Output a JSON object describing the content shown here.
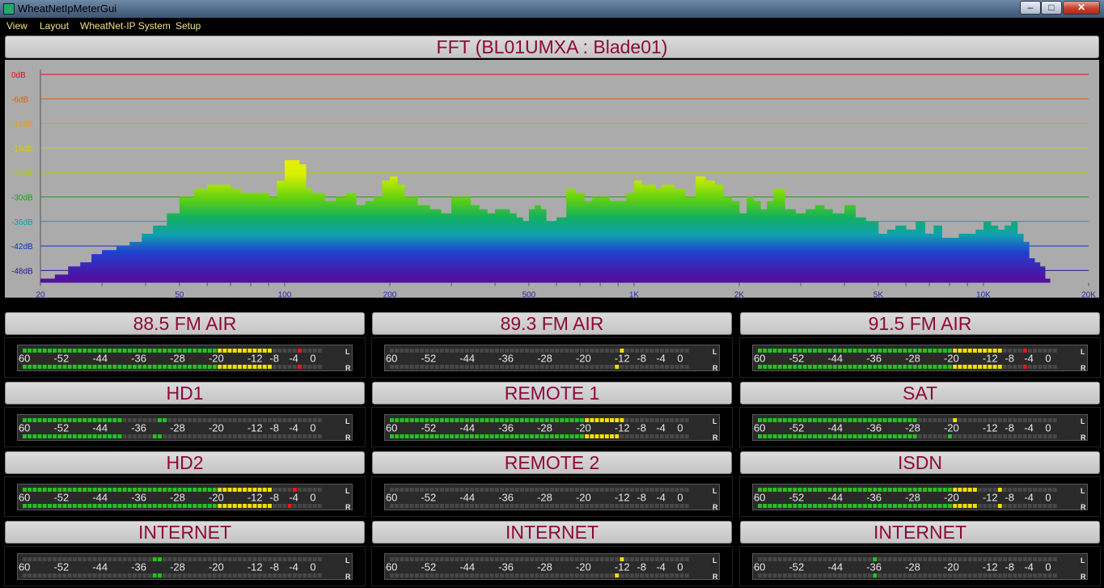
{
  "window": {
    "title": "WheatNetIpMeterGui",
    "minimize_glyph": "–",
    "maximize_glyph": "□",
    "close_glyph": "✕"
  },
  "menu": [
    "View",
    "Layout",
    "WheatNet-IP System",
    "Setup"
  ],
  "fft": {
    "title": "FFT  (BL01UMXA : Blade01)",
    "chart_data": {
      "type": "area",
      "title": "FFT  (BL01UMXA : Blade01)",
      "x_scale": "log",
      "xlim": [
        20,
        20000
      ],
      "ylim": [
        -51,
        0
      ],
      "y_ticks": [
        {
          "label": "0dB",
          "value": 0,
          "color": "#e01010"
        },
        {
          "label": "-6dB",
          "value": -6,
          "color": "#e06010"
        },
        {
          "label": "-12dB",
          "value": -12,
          "color": "#e0a010"
        },
        {
          "label": "-18dB",
          "value": -18,
          "color": "#d8d010"
        },
        {
          "label": "-24dB",
          "value": -24,
          "color": "#a8d010"
        },
        {
          "label": "-30dB",
          "value": -30,
          "color": "#20a020"
        },
        {
          "label": "-36dB",
          "value": -36,
          "color": "#10a0a0"
        },
        {
          "label": "-42dB",
          "value": -42,
          "color": "#1030c0"
        },
        {
          "label": "-48dB",
          "value": -48,
          "color": "#301090"
        }
      ],
      "x_ticks": [
        {
          "label": "20",
          "value": 20
        },
        {
          "label": "50",
          "value": 50
        },
        {
          "label": "100",
          "value": 100
        },
        {
          "label": "200",
          "value": 200
        },
        {
          "label": "500",
          "value": 500
        },
        {
          "label": "1K",
          "value": 1000
        },
        {
          "label": "2K",
          "value": 2000
        },
        {
          "label": "5K",
          "value": 5000
        },
        {
          "label": "10K",
          "value": 10000
        },
        {
          "label": "20K",
          "value": 20000
        }
      ],
      "x": [
        20,
        22,
        24,
        26,
        28,
        30,
        33,
        36,
        39,
        42,
        46,
        50,
        55,
        60,
        65,
        70,
        75,
        80,
        85,
        90,
        95,
        100,
        105,
        110,
        115,
        120,
        130,
        140,
        150,
        160,
        170,
        180,
        190,
        200,
        210,
        220,
        240,
        260,
        280,
        300,
        320,
        340,
        360,
        380,
        400,
        420,
        440,
        460,
        480,
        500,
        520,
        540,
        560,
        600,
        640,
        680,
        720,
        760,
        800,
        850,
        900,
        950,
        1000,
        1050,
        1100,
        1150,
        1200,
        1300,
        1400,
        1500,
        1600,
        1700,
        1800,
        1900,
        2000,
        2100,
        2200,
        2300,
        2400,
        2500,
        2700,
        2900,
        3100,
        3300,
        3500,
        3700,
        4000,
        4300,
        4600,
        5000,
        5300,
        5600,
        6000,
        6400,
        6800,
        7200,
        7600,
        8000,
        8500,
        9000,
        9500,
        10000,
        10500,
        11000,
        11500,
        12000,
        12500,
        13000,
        13500,
        14000,
        14500,
        15000,
        15500,
        16000,
        17000,
        18000,
        19000,
        20000
      ],
      "y": [
        -50,
        -49,
        -47,
        -46,
        -44,
        -43,
        -42,
        -41,
        -39,
        -37,
        -34,
        -30,
        -28,
        -27,
        -27,
        -28,
        -29,
        -29,
        -29,
        -30,
        -26,
        -21,
        -21,
        -22,
        -28,
        -29,
        -31,
        -30,
        -29,
        -32,
        -31,
        -30,
        -26,
        -25,
        -27,
        -30,
        -32,
        -33,
        -34,
        -30,
        -30,
        -32,
        -33,
        -34,
        -33,
        -33,
        -34,
        -35,
        -36,
        -33,
        -32,
        -33,
        -36,
        -35,
        -28,
        -29,
        -31,
        -30,
        -30,
        -31,
        -31,
        -29,
        -26,
        -27,
        -27,
        -28,
        -27,
        -28,
        -30,
        -25,
        -26,
        -27,
        -30,
        -31,
        -34,
        -30,
        -31,
        -33,
        -31,
        -28,
        -33,
        -34,
        -33,
        -32,
        -33,
        -34,
        -32,
        -35,
        -36,
        -39,
        -38,
        -37,
        -38,
        -36,
        -39,
        -37,
        -40,
        -40,
        -39,
        -39,
        -38,
        -36,
        -37,
        -38,
        -37,
        -36,
        -39,
        -41,
        -45,
        -46,
        -47,
        -50,
        -51,
        -51,
        -51,
        -51,
        -51,
        -51
      ]
    }
  },
  "meter_scale": [
    "-60",
    "-52",
    "-44",
    "-36",
    "-28",
    "-20",
    "-12",
    "-8",
    "-4",
    "0"
  ],
  "meter_channel_labels": {
    "left": "L",
    "right": "R"
  },
  "meters": [
    {
      "label": "88.5  FM AIR",
      "left_level": -8,
      "right_level": -8,
      "left_peak": -3,
      "right_peak": -3
    },
    {
      "label": "89.3 FM AIR",
      "left_level": null,
      "right_level": null,
      "left_peak": -12,
      "right_peak": -13
    },
    {
      "label": "91.5 FM AIR",
      "left_level": -9,
      "right_level": -9,
      "left_peak": -5,
      "right_peak": -5
    },
    {
      "label": "HD1",
      "left_level": -39,
      "right_level": -39,
      "left_peak": -31,
      "right_peak": -32
    },
    {
      "label": "REMOTE 1",
      "left_level": -12,
      "right_level": -12,
      "left_peak": -12,
      "right_peak": -13
    },
    {
      "label": "SAT",
      "left_level": -27,
      "right_level": -27,
      "left_peak": -19,
      "right_peak": -20
    },
    {
      "label": "HD2",
      "left_level": -8,
      "right_level": -8,
      "left_peak": -4,
      "right_peak": -5
    },
    {
      "label": "REMOTE 2",
      "left_level": null,
      "right_level": null,
      "left_peak": null,
      "right_peak": null
    },
    {
      "label": "ISDN",
      "left_level": -15,
      "right_level": -15,
      "left_peak": -10,
      "right_peak": -10
    },
    {
      "label": "INTERNET",
      "left_level": null,
      "right_level": null,
      "left_peak": -32,
      "right_peak": -32
    },
    {
      "label": "INTERNET",
      "left_level": null,
      "right_level": null,
      "left_peak": -12,
      "right_peak": -13
    },
    {
      "label": "INTERNET",
      "left_level": null,
      "right_level": null,
      "left_peak": -36,
      "right_peak": -36
    }
  ],
  "colors": {
    "meter_green": "#22c222",
    "meter_yellow": "#f2e000",
    "meter_red": "#e81818",
    "meter_off": "#474747",
    "label_color": "#8c0a3c",
    "menu_color": "#f1e38a",
    "axis_label_color": "#2a2aa8"
  }
}
